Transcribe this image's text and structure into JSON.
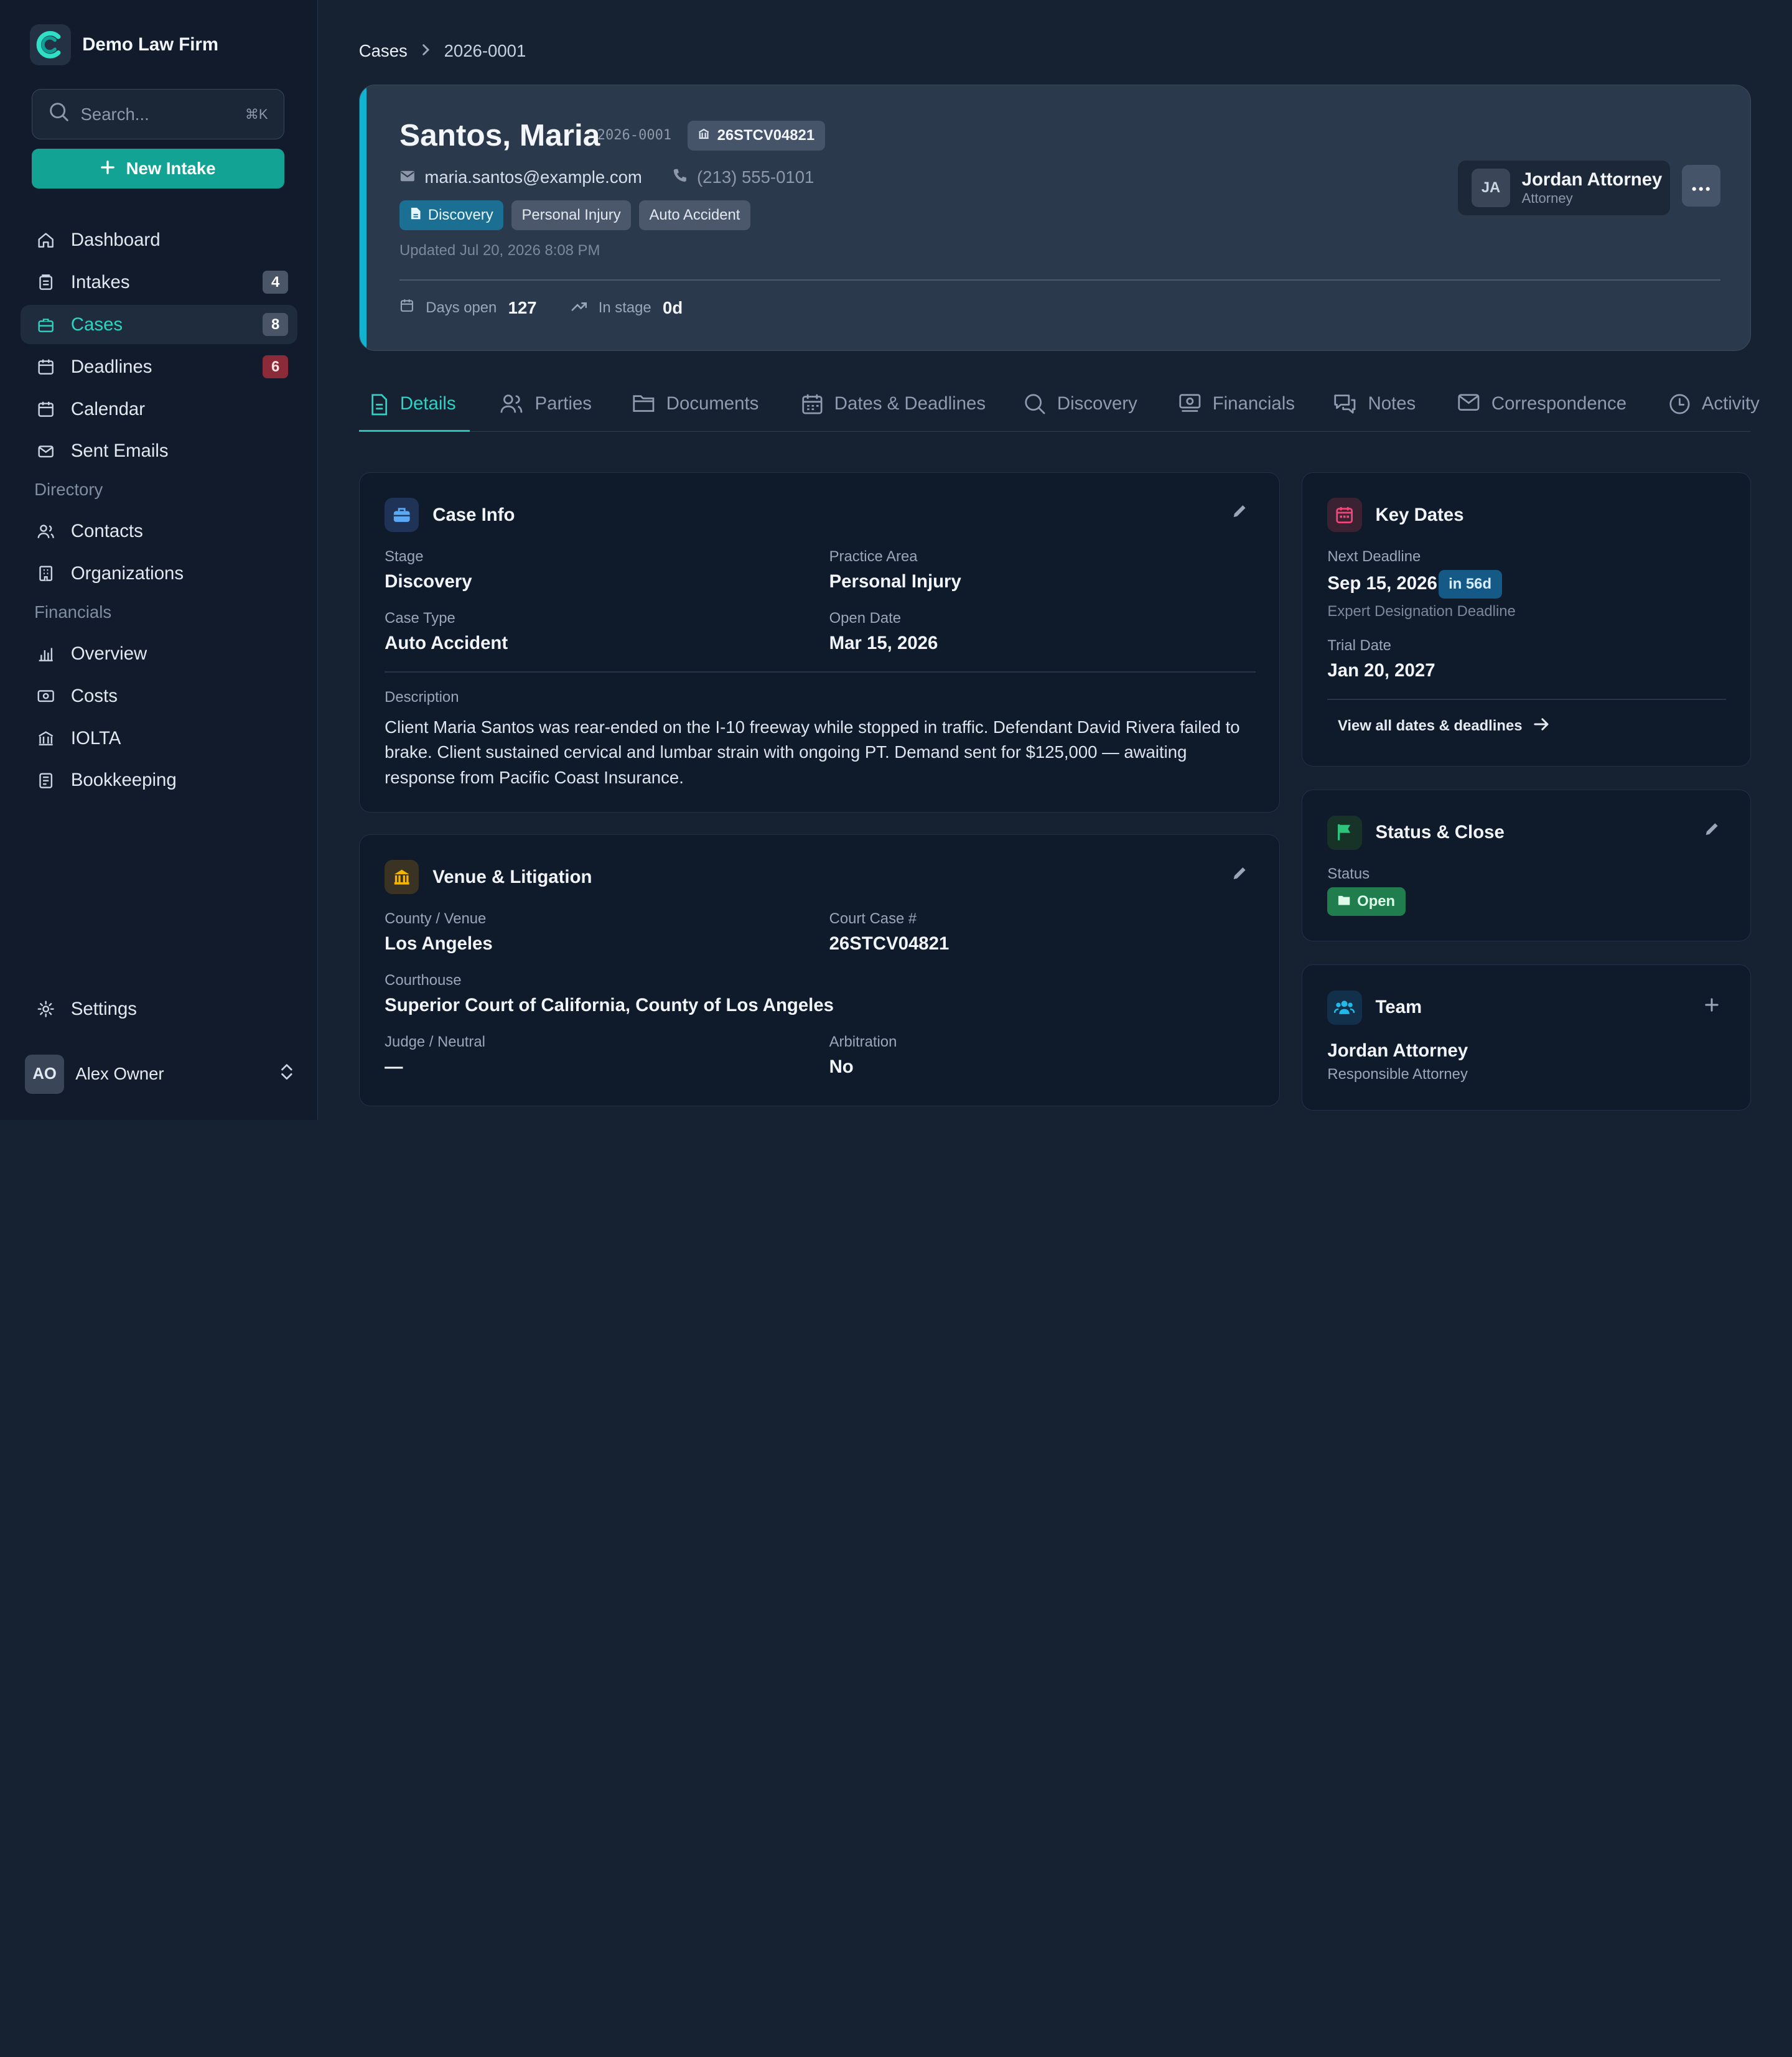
{
  "brand": {
    "name": "Demo Law Firm"
  },
  "sidebar": {
    "search_placeholder": "Search...",
    "search_shortcut": "⌘K",
    "new_intake_label": "New Intake",
    "nav": [
      {
        "label": "Dashboard",
        "icon": "home-icon"
      },
      {
        "label": "Intakes",
        "icon": "intakes-icon",
        "badge": "4"
      },
      {
        "label": "Cases",
        "icon": "briefcase-icon",
        "badge": "8",
        "active": true
      },
      {
        "label": "Deadlines",
        "icon": "calendar-icon",
        "badge": "6"
      },
      {
        "label": "Calendar",
        "icon": "calendar-icon"
      },
      {
        "label": "Sent Emails",
        "icon": "mail-icon"
      }
    ],
    "directory_heading": "Directory",
    "directory": [
      {
        "label": "Contacts",
        "icon": "users-icon"
      },
      {
        "label": "Organizations",
        "icon": "building-icon"
      }
    ],
    "financials_heading": "Financials",
    "financials": [
      {
        "label": "Overview",
        "icon": "bar-chart-icon"
      },
      {
        "label": "Costs",
        "icon": "cash-icon"
      },
      {
        "label": "IOLTA",
        "icon": "bank-icon"
      },
      {
        "label": "Bookkeeping",
        "icon": "ledger-icon"
      }
    ],
    "settings_label": "Settings",
    "user": {
      "initials": "AO",
      "name": "Alex Owner"
    }
  },
  "breadcrumb": {
    "parent": "Cases",
    "current": "2026-0001"
  },
  "case_header": {
    "client_name": "Santos, Maria",
    "case_number": "2026-0001",
    "court_case_number": "26STCV04821",
    "email": "maria.santos@example.com",
    "phone": "(213) 555-0101",
    "tags": [
      "Discovery",
      "Personal Injury",
      "Auto Accident"
    ],
    "updated": "Updated Jul 20, 2026 8:08 PM",
    "days_open_label": "Days open",
    "days_open_value": "127",
    "in_stage_label": "In stage",
    "in_stage_value": "0d",
    "attorney": {
      "initials": "JA",
      "name": "Jordan Attorney",
      "role": "Attorney"
    }
  },
  "tabs": [
    "Details",
    "Parties",
    "Documents",
    "Dates & Deadlines",
    "Discovery",
    "Financials",
    "Notes",
    "Correspondence",
    "Activity"
  ],
  "case_info": {
    "title": "Case Info",
    "stage_label": "Stage",
    "stage": "Discovery",
    "practice_area_label": "Practice Area",
    "practice_area": "Personal Injury",
    "case_type_label": "Case Type",
    "case_type": "Auto Accident",
    "open_date_label": "Open Date",
    "open_date": "Mar 15, 2026",
    "description_label": "Description",
    "description": "Client Maria Santos was rear-ended on the I-10 freeway while stopped in traffic. Defendant David Rivera failed to brake. Client sustained cervical and lumbar strain with ongoing PT. Demand sent for $125,000 — awaiting response from Pacific Coast Insurance."
  },
  "venue": {
    "title": "Venue & Litigation",
    "county_label": "County / Venue",
    "county": "Los Angeles",
    "court_case_label": "Court Case #",
    "court_case": "26STCV04821",
    "courthouse_label": "Courthouse",
    "courthouse": "Superior Court of California, County of Los Angeles",
    "judge_label": "Judge / Neutral",
    "judge": "—",
    "arbitration_label": "Arbitration",
    "arbitration": "No"
  },
  "key_dates": {
    "title": "Key Dates",
    "next_deadline_label": "Next Deadline",
    "next_deadline": "Sep 15, 2026",
    "next_deadline_in": "in 56d",
    "next_deadline_name": "Expert Designation Deadline",
    "trial_date_label": "Trial Date",
    "trial_date": "Jan 20, 2027",
    "view_all": "View all dates & deadlines"
  },
  "status_close": {
    "title": "Status & Close",
    "status_label": "Status",
    "status": "Open"
  },
  "team": {
    "title": "Team",
    "member_name": "Jordan Attorney",
    "member_role": "Responsible Attorney"
  },
  "colors": {
    "accent": "#13a394",
    "active_text": "#2cd5c0",
    "header_accent": "#12b3d0",
    "discovery_tag": "#1a6f93",
    "status_open": "#1f7d4e"
  }
}
